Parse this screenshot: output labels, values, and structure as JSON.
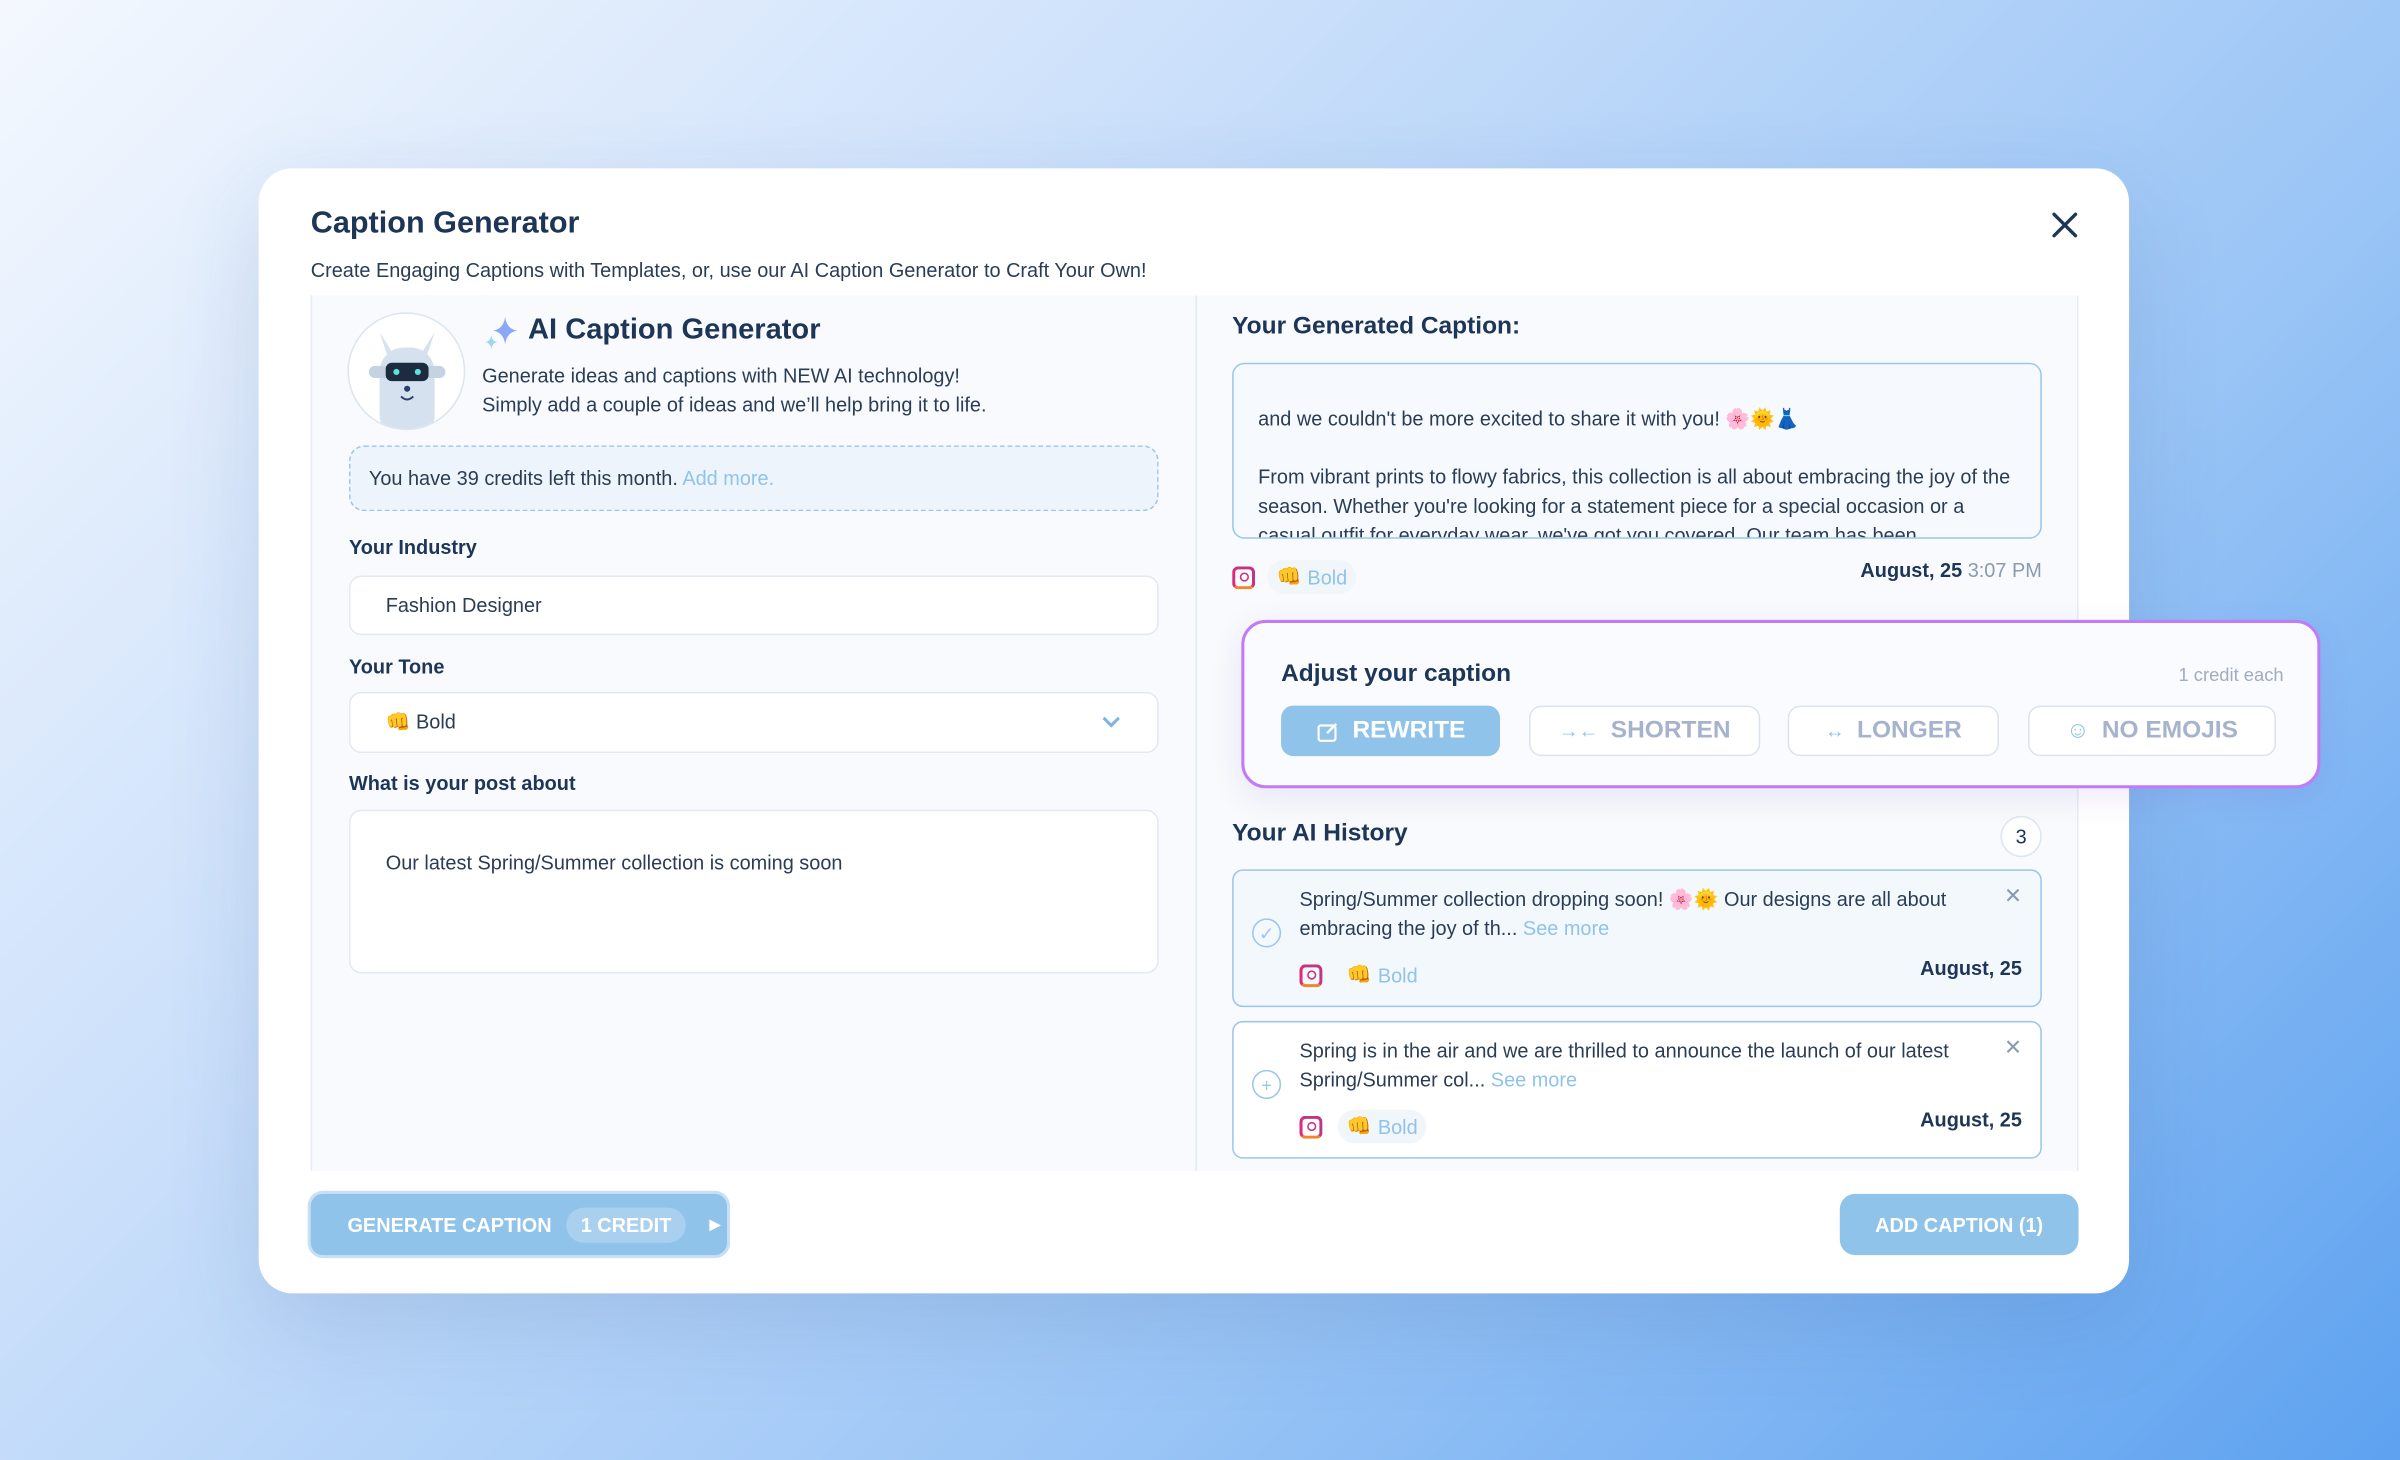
{
  "modal": {
    "title": "Caption Generator",
    "subtitle": "Create Engaging Captions with Templates, or, use our AI Caption Generator to Craft Your Own!"
  },
  "ai": {
    "heading": "AI Caption Generator",
    "desc1": "Generate ideas and captions with NEW AI technology!",
    "desc2": "Simply add a couple of ideas and we’ll help bring it to life.",
    "credits_text": "You have 39 credits left this month.",
    "credits_link": "Add more."
  },
  "form": {
    "industry_label": "Your Industry",
    "industry_value": "Fashion Designer",
    "tone_label": "Your Tone",
    "tone_emoji": "👊",
    "tone_value": "Bold",
    "post_label": "What is your post about",
    "post_value": "Our latest Spring/Summer collection is coming soon"
  },
  "generated": {
    "heading": "Your Generated Caption:",
    "line1": "and we couldn't be more excited to share it with you! 🌸🌞👗",
    "para2": "From vibrant prints to flowy fabrics, this collection is all about embracing the joy of the season. Whether you're looking for a statement piece for a special occasion or a casual outfit for everyday wear, we've got you covered. Our team has been",
    "tone_emoji": "👊",
    "tone": "Bold",
    "date": "August, 25",
    "time": "3:07 PM"
  },
  "adjust": {
    "title": "Adjust your caption",
    "note": "1 credit each",
    "buttons": [
      {
        "label": "REWRITE",
        "icon": "edit-icon"
      },
      {
        "label": "SHORTEN",
        "icon": "arrows-in-icon"
      },
      {
        "label": "LONGER",
        "icon": "arrows-out-icon"
      },
      {
        "label": "NO EMOJIS",
        "icon": "smiley-icon"
      }
    ]
  },
  "history": {
    "heading": "Your AI History",
    "count": "3",
    "items": [
      {
        "text": "Spring/Summer collection dropping soon! 🌸🌞 Our designs are all about embracing the joy of th...",
        "see_more": "See more",
        "tone_emoji": "👊",
        "tone": "Bold",
        "date": "August, 25",
        "selected": true
      },
      {
        "text": "Spring is in the air and we are thrilled to announce the launch of our latest Spring/Summer col...",
        "see_more": "See more",
        "tone_emoji": "👊",
        "tone": "Bold",
        "date": "August, 25",
        "selected": false
      }
    ]
  },
  "footer": {
    "generate_label": "GENERATE CAPTION",
    "generate_cost": "1 CREDIT",
    "add_label": "ADD CAPTION (1)"
  },
  "colors": {
    "accent": "#8fc3ea",
    "title": "#1d3557",
    "popup_border": "#c17cf5"
  }
}
